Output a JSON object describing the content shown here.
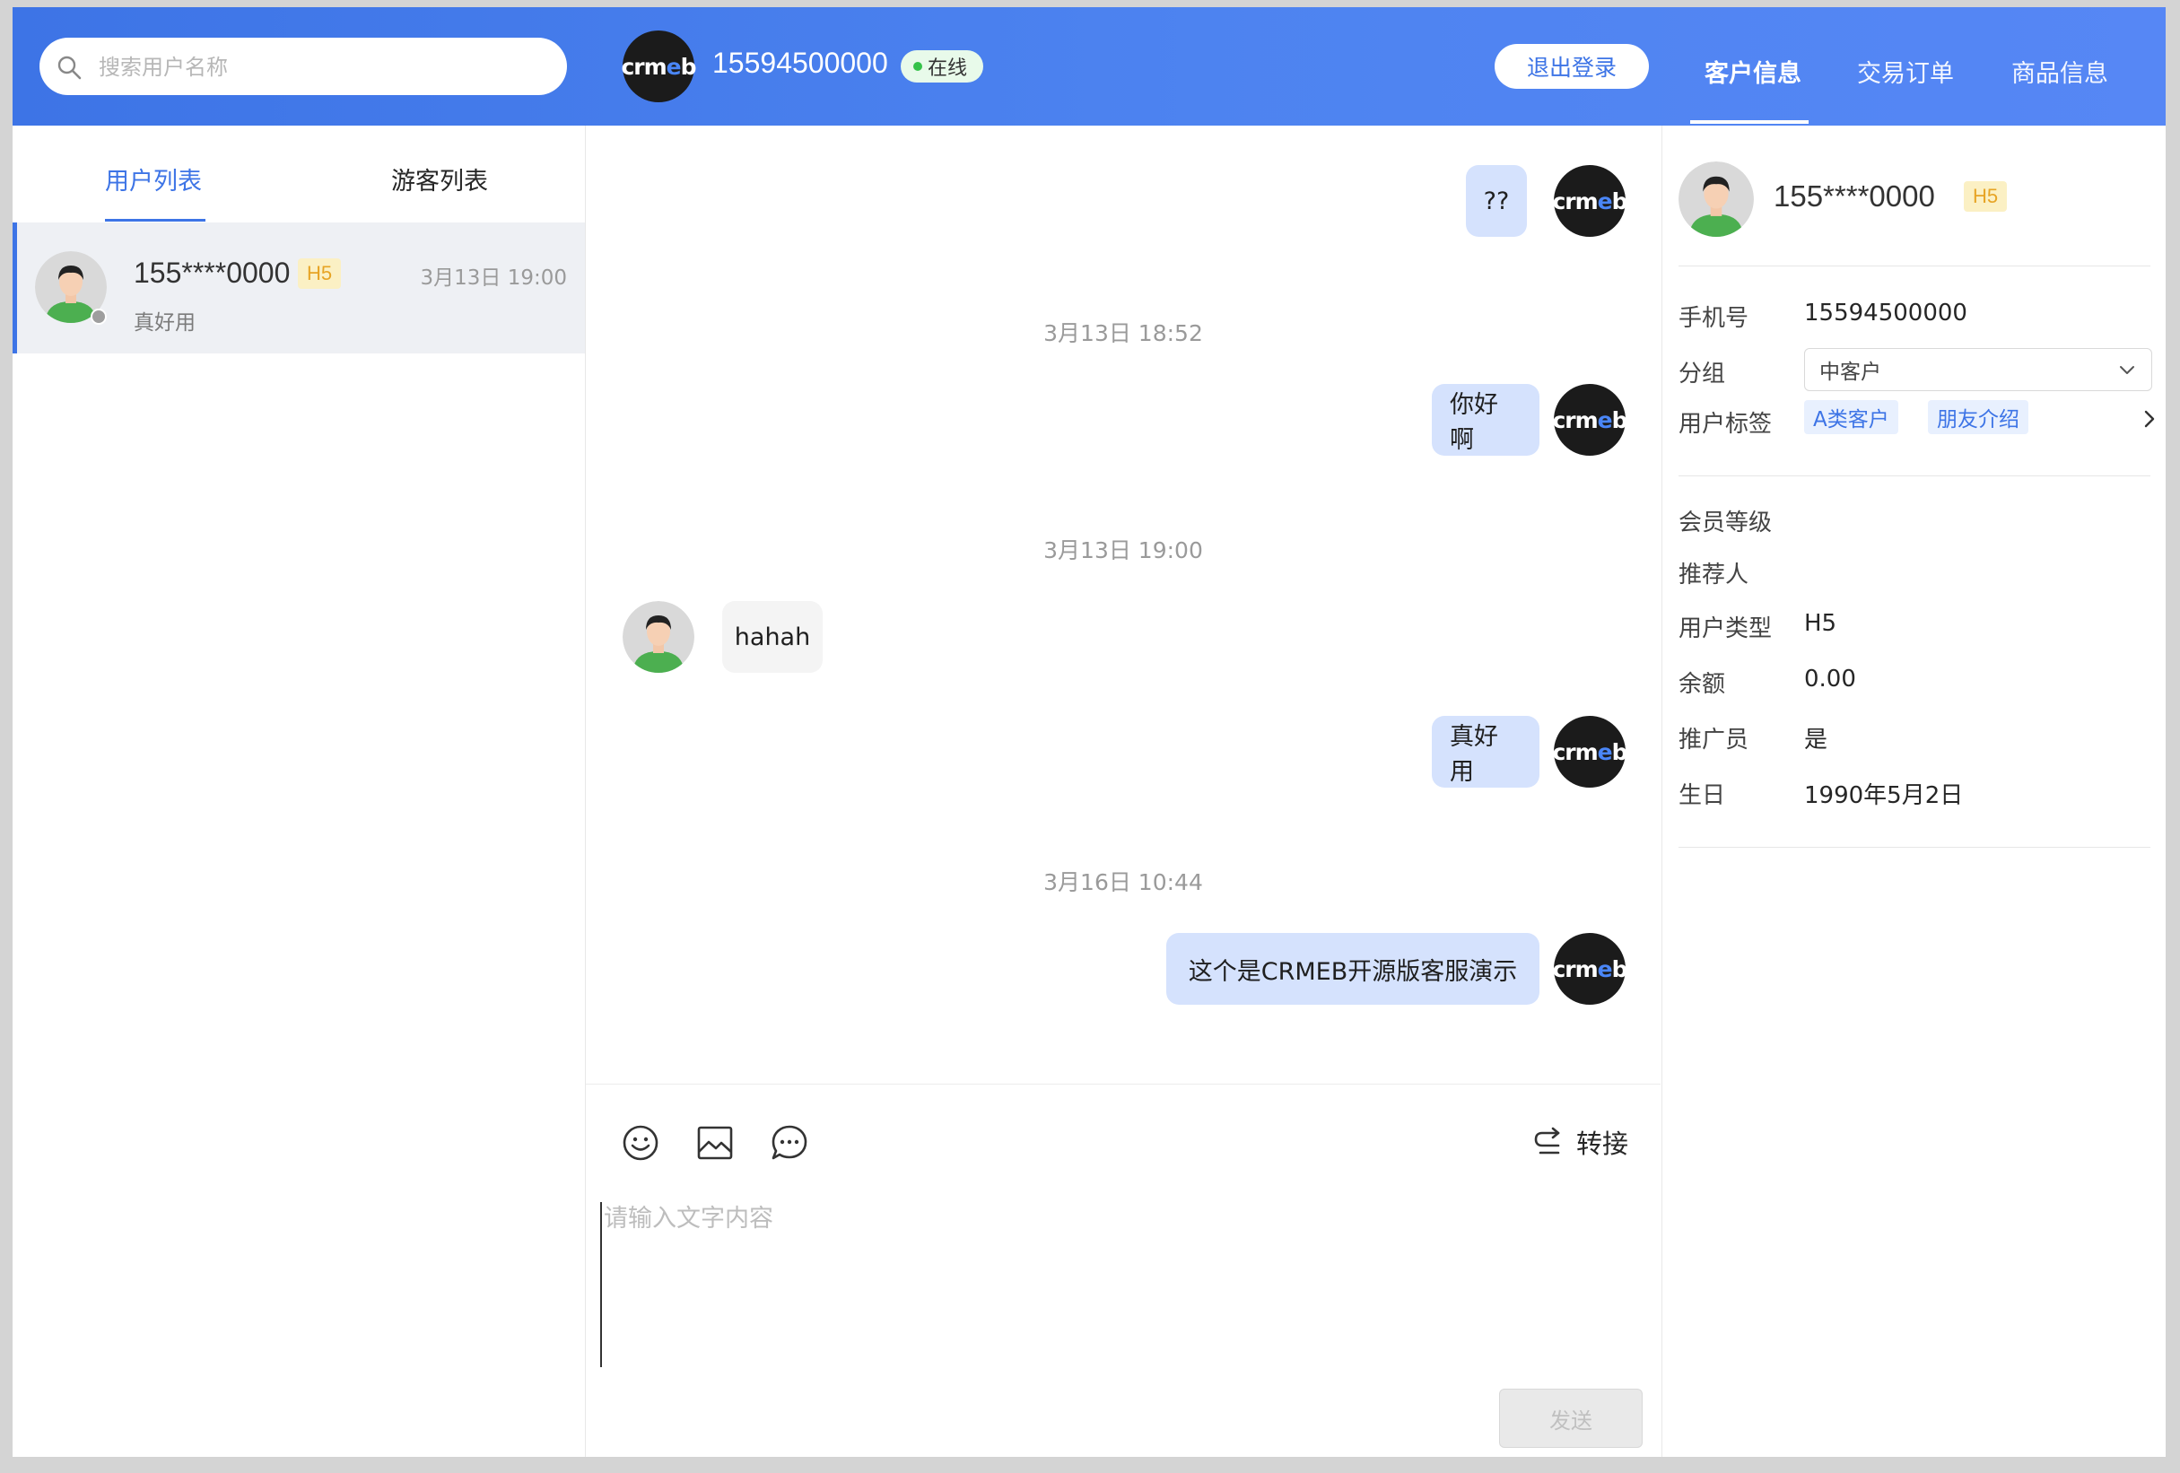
{
  "header": {
    "search_placeholder": "搜索用户名称",
    "phone": "15594500000",
    "status": "在线",
    "logout_label": "退出登录",
    "tabs": [
      "客户信息",
      "交易订单",
      "商品信息"
    ]
  },
  "left_panel": {
    "tabs": [
      "用户列表",
      "游客列表"
    ],
    "users": [
      {
        "name": "155****0000",
        "badge": "H5",
        "time": "3月13日 19:00",
        "last_message": "真好用"
      }
    ]
  },
  "brand": {
    "logo_text_a": "crm",
    "logo_text_b": "e",
    "logo_text_c": "b"
  },
  "chat": {
    "messages": [
      {
        "side": "me",
        "text": "??"
      },
      {
        "separator": "3月13日 18:52"
      },
      {
        "side": "me",
        "text": "你好啊"
      },
      {
        "separator": "3月13日 19:00"
      },
      {
        "side": "them",
        "text": "hahah"
      },
      {
        "side": "me",
        "text": "真好用"
      },
      {
        "separator": "3月16日 10:44"
      },
      {
        "side": "me",
        "text": "这个是CRMEB开源版客服演示"
      }
    ],
    "transfer_label": "转接",
    "input_placeholder": "请输入文字内容",
    "send_label": "发送"
  },
  "customer": {
    "name": "155****0000",
    "badge": "H5",
    "phone_label": "手机号",
    "phone": "15594500000",
    "group_label": "分组",
    "group_value": "中客户",
    "tags_label": "用户标签",
    "tags": [
      "A类客户",
      "朋友介绍"
    ],
    "level_label": "会员等级",
    "level": "",
    "referrer_label": "推荐人",
    "referrer": "",
    "user_type_label": "用户类型",
    "user_type": "H5",
    "balance_label": "余额",
    "balance": "0.00",
    "promoter_label": "推广员",
    "promoter": "是",
    "birthday_label": "生日",
    "birthday": "1990年5月2日"
  },
  "colors": {
    "accent": "#3d74e6",
    "header_gradient_end": "#5687f5",
    "my_bubble": "#d5e2fd",
    "their_bubble": "#f4f4f4",
    "online_dot": "#35c24a",
    "badge_bg": "#fbf0c4",
    "badge_text": "#e7a425"
  },
  "icons": [
    "search-icon",
    "emoji-icon",
    "image-icon",
    "quick-reply-icon",
    "transfer-icon",
    "chevron-down-icon",
    "chevron-right-icon"
  ]
}
